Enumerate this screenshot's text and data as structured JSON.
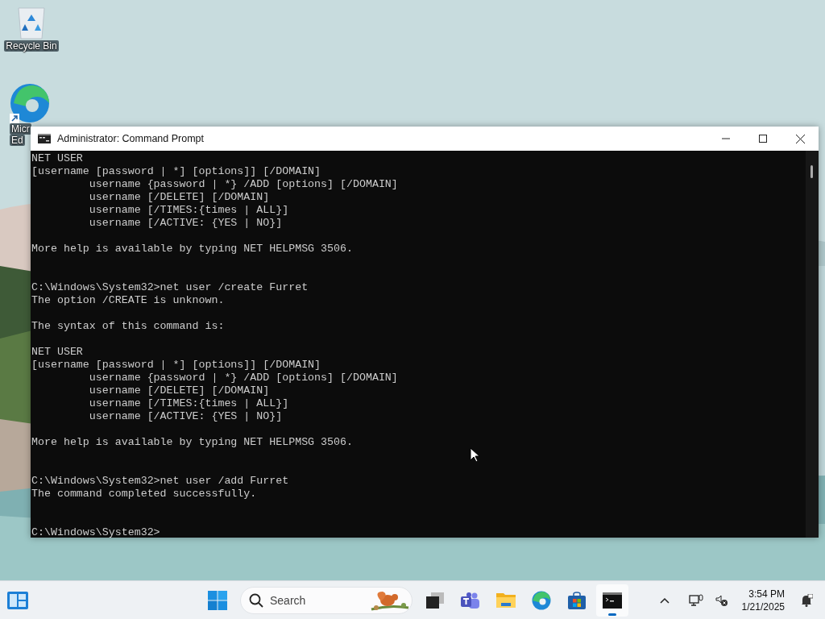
{
  "desktop_icons": [
    {
      "kind": "recycle-bin",
      "label": [
        "Recycle Bin"
      ]
    },
    {
      "kind": "edge",
      "label": [
        "Micr",
        "Ed"
      ]
    }
  ],
  "window": {
    "title": "Administrator: Command Prompt",
    "console": [
      {
        "kind": "text",
        "text": "NET USER"
      },
      {
        "kind": "text",
        "text": "[username [password | *] [options]] [/DOMAIN]"
      },
      {
        "kind": "text",
        "text": "         username {password | *} /ADD [options] [/DOMAIN]"
      },
      {
        "kind": "text",
        "text": "         username [/DELETE] [/DOMAIN]"
      },
      {
        "kind": "text",
        "text": "         username [/TIMES:{times | ALL}]"
      },
      {
        "kind": "text",
        "text": "         username [/ACTIVE: {YES | NO}]"
      },
      {
        "kind": "blank"
      },
      {
        "kind": "text",
        "text": "More help is available by typing NET HELPMSG 3506."
      },
      {
        "kind": "blank"
      },
      {
        "kind": "blank"
      },
      {
        "kind": "text",
        "text": "C:\\Windows\\System32>net user /create Furret"
      },
      {
        "kind": "text",
        "text": "The option /CREATE is unknown."
      },
      {
        "kind": "blank"
      },
      {
        "kind": "text",
        "text": "The syntax of this command is:"
      },
      {
        "kind": "blank"
      },
      {
        "kind": "text",
        "text": "NET USER"
      },
      {
        "kind": "text",
        "text": "[username [password | *] [options]] [/DOMAIN]"
      },
      {
        "kind": "text",
        "text": "         username {password | *} /ADD [options] [/DOMAIN]"
      },
      {
        "kind": "text",
        "text": "         username [/DELETE] [/DOMAIN]"
      },
      {
        "kind": "text",
        "text": "         username [/TIMES:{times | ALL}]"
      },
      {
        "kind": "text",
        "text": "         username [/ACTIVE: {YES | NO}]"
      },
      {
        "kind": "blank"
      },
      {
        "kind": "text",
        "text": "More help is available by typing NET HELPMSG 3506."
      },
      {
        "kind": "blank"
      },
      {
        "kind": "blank"
      },
      {
        "kind": "text",
        "text": "C:\\Windows\\System32>net user /add Furret"
      },
      {
        "kind": "text",
        "text": "The command completed successfully."
      },
      {
        "kind": "blank"
      },
      {
        "kind": "blank"
      },
      {
        "kind": "text",
        "text": "C:\\Windows\\System32>"
      }
    ]
  },
  "taskbar": {
    "search": {
      "placeholder": "Search"
    },
    "apps": [
      {
        "kind": "task-view",
        "selected": false
      },
      {
        "kind": "teams",
        "selected": false
      },
      {
        "kind": "folder",
        "selected": false
      },
      {
        "kind": "edge",
        "selected": false
      },
      {
        "kind": "store",
        "selected": false
      },
      {
        "kind": "terminal",
        "selected": true
      }
    ],
    "time": "3:54 PM",
    "date": "1/21/2025"
  }
}
